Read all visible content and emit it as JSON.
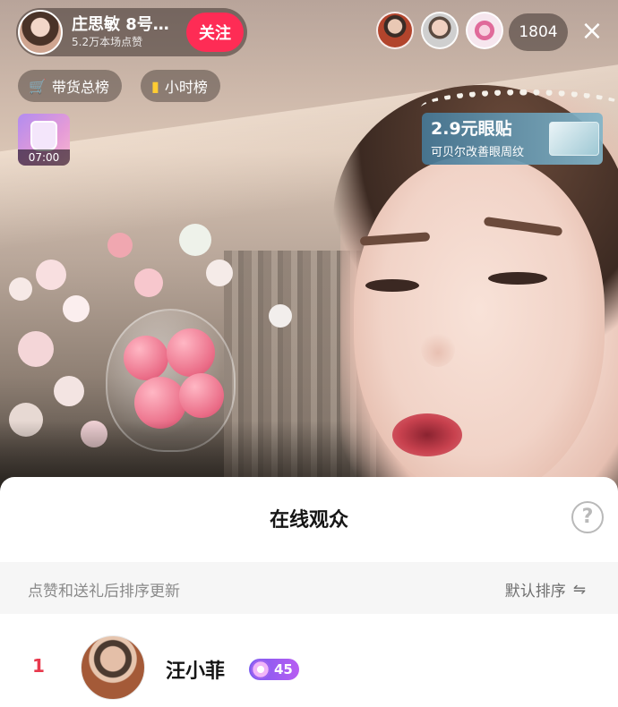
{
  "host": {
    "name": "庄思敏 8号…",
    "likes": "5.2万本场点赞",
    "follow_label": "关注"
  },
  "top_viewers": [
    "viewer-avatar-1",
    "viewer-avatar-2",
    "viewer-avatar-3"
  ],
  "viewer_count": "1804",
  "close_icon": "×",
  "chips": {
    "sales_rank": "带货总榜",
    "hourly_rank": "小时榜"
  },
  "gift": {
    "timer": "07:00"
  },
  "ad": {
    "title": "2.9元眼贴",
    "subtitle": "可贝尔改善眼周纹"
  },
  "sheet": {
    "title": "在线观众",
    "help_icon": "?",
    "hint": "点赞和送礼后排序更新",
    "sort_label": "默认排序",
    "sort_icon": "⇋"
  },
  "viewers": [
    {
      "rank": "1",
      "name": "汪小菲",
      "level": "45"
    }
  ],
  "colors": {
    "follow": "#fe2c55",
    "rank_first": "#e8394d",
    "level_badge": "#8a5cf0"
  }
}
